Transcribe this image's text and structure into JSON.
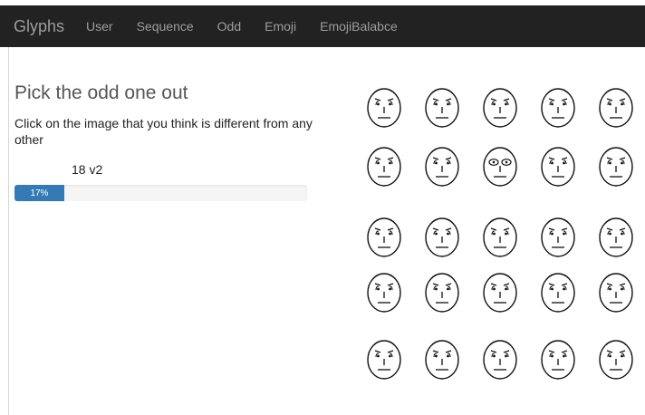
{
  "navbar": {
    "brand": "Glyphs",
    "items": [
      "User",
      "Sequence",
      "Odd",
      "Emoji",
      "EmojiBalabce"
    ]
  },
  "main": {
    "title": "Pick the odd one out",
    "instructions": "Click on the image that you think is different from any other",
    "trial_label": "18 v2",
    "progress": {
      "percent": 17,
      "label": "17%"
    }
  },
  "glyph_grid": {
    "rows": 5,
    "cols": 5,
    "odd_cell": {
      "row": 2,
      "col": 3
    },
    "odd_variant": "round-eyes",
    "normal_variant": "dot-eyes"
  },
  "colors": {
    "navbar_bg": "#222222",
    "nav_text": "#9d9d9d",
    "progress_fill": "#337ab7",
    "progress_track": "#f5f5f5"
  }
}
